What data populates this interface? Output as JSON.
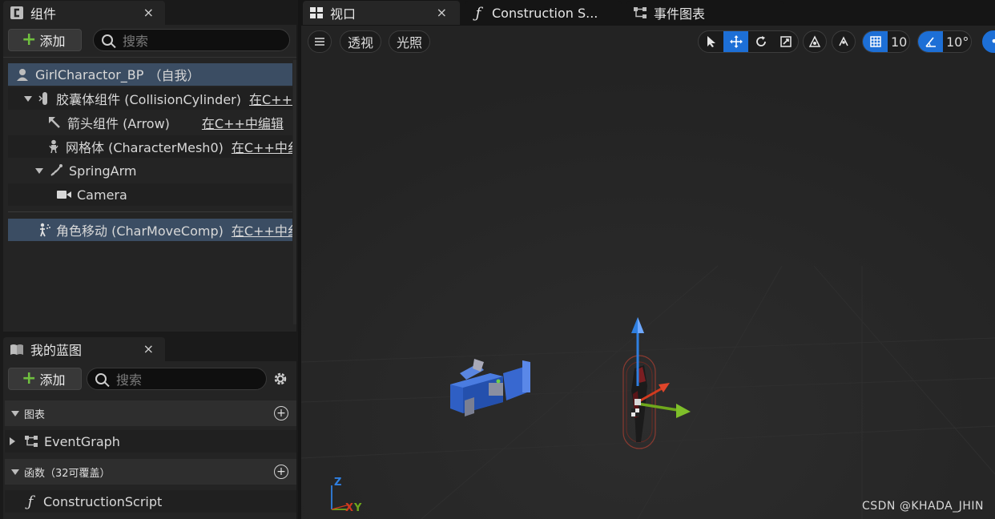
{
  "components_panel": {
    "tab_title": "组件",
    "tab_close": "×",
    "add_label": "添加",
    "search_placeholder": "搜索",
    "root": {
      "name": "GirlCharactor_BP",
      "suffix": "（自我）"
    },
    "items": [
      {
        "label": "胶囊体组件 (CollisionCylinder)",
        "cpp": "在C++",
        "icon": "capsule-icon"
      },
      {
        "label": "箭头组件 (Arrow)",
        "cpp": "在C++中编辑",
        "icon": "arrow-icon"
      },
      {
        "label": "网格体 (CharacterMesh0)",
        "cpp": "在C++中纟",
        "icon": "mesh-icon"
      },
      {
        "label": "SpringArm",
        "cpp": "",
        "icon": "springarm-icon"
      },
      {
        "label": "Camera",
        "cpp": "",
        "icon": "camera-icon"
      },
      {
        "label": "角色移动 (CharMoveComp)",
        "cpp": "在C++中纟",
        "icon": "movement-icon"
      }
    ]
  },
  "blueprint_panel": {
    "tab_title": "我的蓝图",
    "tab_close": "×",
    "add_label": "添加",
    "search_placeholder": "搜索",
    "graphs_header": "图表",
    "graphs": [
      "EventGraph"
    ],
    "functions_header": "函数（32可覆盖）",
    "functions": [
      "ConstructionScript"
    ]
  },
  "editor_tabs": [
    {
      "label": "视口",
      "close": "×",
      "active": true,
      "icon": "viewport-icon"
    },
    {
      "label": "Construction S...",
      "active": false,
      "icon": "function-icon"
    },
    {
      "label": "事件图表",
      "active": false,
      "icon": "graph-icon"
    }
  ],
  "viewport_toolbar": {
    "perspective_label": "透视",
    "lighting_label": "光照",
    "grid_snap_value": "10",
    "rotation_snap_value": "10°"
  },
  "axis_labels": {
    "z": "Z",
    "x": "X",
    "y": "Y"
  },
  "watermark": "CSDN @KHADA_JHIN",
  "colors": {
    "accent_blue": "#1d6fd6",
    "selection": "#3b4d63",
    "add_plus_green": "#6fbf3f",
    "axis_x": "#d23a1e",
    "axis_y": "#6fa81c",
    "axis_z": "#2f7fe0"
  }
}
